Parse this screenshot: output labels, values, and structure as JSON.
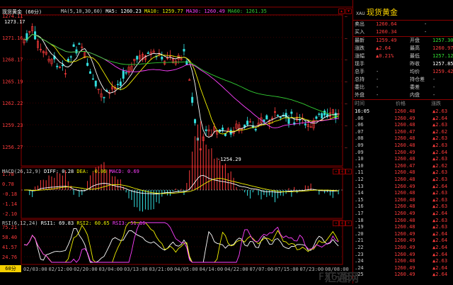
{
  "chart": {
    "symbol_name": "现货黄金",
    "period": "(60分)",
    "ma_items": [
      {
        "label": "MA(5,10,30,60)",
        "color": "#c8c8c8"
      },
      {
        "label": "MA5: 1260.23",
        "color": "#ffffff"
      },
      {
        "label": "MA10: 1259.77",
        "color": "#f2f200"
      },
      {
        "label": "MA30: 1260.49",
        "color": "#ff40ff"
      },
      {
        "label": "MA60: 1261.35",
        "color": "#33cc33"
      }
    ],
    "y_ticks": [
      "1274.11",
      "1271.16",
      "1268.17",
      "1265.19",
      "1262.22",
      "1259.23",
      "1256.27"
    ],
    "high_marker": "1273.17",
    "low_marker": "-1254.29",
    "macd_items": [
      {
        "label": "MACD(26,12,9)",
        "color": "#c8c8c8"
      },
      {
        "label": "DIFF: 0.28",
        "color": "#ffffff"
      },
      {
        "label": "DEA: -0.06",
        "color": "#f2f200"
      },
      {
        "label": "MACD: 0.69",
        "color": "#ff40ff"
      }
    ],
    "macd_ticks": [
      "1.78",
      "0.78",
      "-0.18",
      "-1.14",
      "-2.10"
    ],
    "rsi_items": [
      {
        "label": "RSI(6,12,24)",
        "color": "#c8c8c8"
      },
      {
        "label": "RSI1: 69.83",
        "color": "#ffffff"
      },
      {
        "label": "RSI2: 60.65",
        "color": "#f2f200"
      },
      {
        "label": "RSI3: 51.16",
        "color": "#ff40ff"
      }
    ],
    "rsi_ticks": [
      "75.21",
      "58.40",
      "41.57",
      "24.76"
    ],
    "period_button": "60分",
    "x_ticks": [
      "02/03:00",
      "02/12:00",
      "02/20:00",
      "03/04:00",
      "03/13:00",
      "03/21:00",
      "04/05:00",
      "04/14:00",
      "04/22:00",
      "07/07:00",
      "07/15:00",
      "07/23:00",
      "08/08:00"
    ],
    "colors": {
      "up": "#ff3c3c",
      "down": "#33e0e0",
      "grid": "#8b0000",
      "axis_text": "#ff3c3c"
    }
  },
  "side": {
    "code": "XAU",
    "name": "现货黄金",
    "sell": {
      "label": "卖出",
      "value": "1260.64",
      "vol": "-"
    },
    "buy": {
      "label": "买入",
      "value": "1260.34",
      "vol": "-"
    },
    "quote_rows": [
      {
        "l1": "最新",
        "v1": "1259.49",
        "c1": "#ff3c3c",
        "l2": "开盘",
        "v2": "1257.30",
        "c2": "#33e033"
      },
      {
        "l1": "涨跌",
        "v1": "▲2.64",
        "c1": "#ff3c3c",
        "l2": "最高",
        "v2": "1260.97",
        "c2": "#ff3c3c"
      },
      {
        "l1": "涨幅",
        "v1": "▲0.21%",
        "c1": "#ff3c3c",
        "l2": "最低",
        "v2": "1257.12",
        "c2": "#33e033"
      },
      {
        "l1": "现手",
        "v1": "",
        "c1": "#ccc",
        "l2": "昨收",
        "v2": "1257.85",
        "c2": "#ffffff"
      },
      {
        "l1": "总手",
        "v1": "-",
        "c1": "#ccc",
        "l2": "均价",
        "v2": "1259.42",
        "c2": "#ff3c3c"
      },
      {
        "l1": "总持",
        "v1": "-",
        "c1": "#ccc",
        "l2": "持仓差",
        "v2": "-",
        "c2": "#ccc"
      },
      {
        "l1": "委比",
        "v1": "-",
        "c1": "#ccc",
        "l2": "委差",
        "v2": "-",
        "c2": "#ccc"
      },
      {
        "l1": "外盘",
        "v1": "-",
        "c1": "#ccc",
        "l2": "内盘",
        "v2": "-",
        "c2": "#ccc"
      }
    ],
    "tick_header": {
      "time": "时间",
      "price": "价格",
      "change": "涨跌"
    },
    "ticks": [
      {
        "time": "16:05",
        "price": "1260.48",
        "change": "2.63",
        "arrow": "▲"
      },
      {
        "time": ".06",
        "price": "1260.49",
        "change": "2.64",
        "arrow": "▲"
      },
      {
        "time": ".06",
        "price": "1260.48",
        "change": "2.63",
        "arrow": "▲"
      },
      {
        "time": ".07",
        "price": "1260.47",
        "change": "2.62",
        "arrow": "▲"
      },
      {
        "time": ".08",
        "price": "1260.48",
        "change": "2.63",
        "arrow": "▲"
      },
      {
        "time": ".09",
        "price": "1260.48",
        "change": "2.63",
        "arrow": "▲"
      },
      {
        "time": ".09",
        "price": "1260.49",
        "change": "2.64",
        "arrow": "▲"
      },
      {
        "time": ".10",
        "price": "1260.48",
        "change": "2.63",
        "arrow": "▲"
      },
      {
        "time": ".10",
        "price": "1260.47",
        "change": "2.62",
        "arrow": "▲"
      },
      {
        "time": ".11",
        "price": "1260.48",
        "change": "2.63",
        "arrow": "▲"
      },
      {
        "time": ".12",
        "price": "1260.48",
        "change": "2.63",
        "arrow": "▲"
      },
      {
        "time": ".13",
        "price": "1260.49",
        "change": "2.64",
        "arrow": "▲"
      },
      {
        "time": ".14",
        "price": "1260.48",
        "change": "2.63",
        "arrow": "▲"
      },
      {
        "time": ".15",
        "price": "1260.48",
        "change": "2.63",
        "arrow": "▲"
      },
      {
        "time": ".16",
        "price": "1260.48",
        "change": "2.63",
        "arrow": "▲"
      },
      {
        "time": ".17",
        "price": "1260.49",
        "change": "2.64",
        "arrow": "▲"
      },
      {
        "time": ".18",
        "price": "1260.48",
        "change": "2.63",
        "arrow": "▲"
      },
      {
        "time": ".19",
        "price": "1260.48",
        "change": "2.63",
        "arrow": "▲"
      },
      {
        "time": ".20",
        "price": "1260.49",
        "change": "2.64",
        "arrow": "▲"
      },
      {
        "time": ".21",
        "price": "1260.49",
        "change": "2.64",
        "arrow": "▲"
      },
      {
        "time": ".22",
        "price": "1260.49",
        "change": "2.64",
        "arrow": "▲"
      },
      {
        "time": ".23",
        "price": "1260.49",
        "change": "2.64",
        "arrow": "▲"
      },
      {
        "time": ".24",
        "price": "1260.48",
        "change": "2.63",
        "arrow": "▲"
      },
      {
        "time": ".24",
        "price": "1260.49",
        "change": "2.64",
        "arrow": "▲"
      },
      {
        "time": ".25",
        "price": "1260.49",
        "change": "2.64",
        "arrow": "▲"
      }
    ],
    "watermark": "FX678",
    "watermark2": "汇通网"
  }
}
